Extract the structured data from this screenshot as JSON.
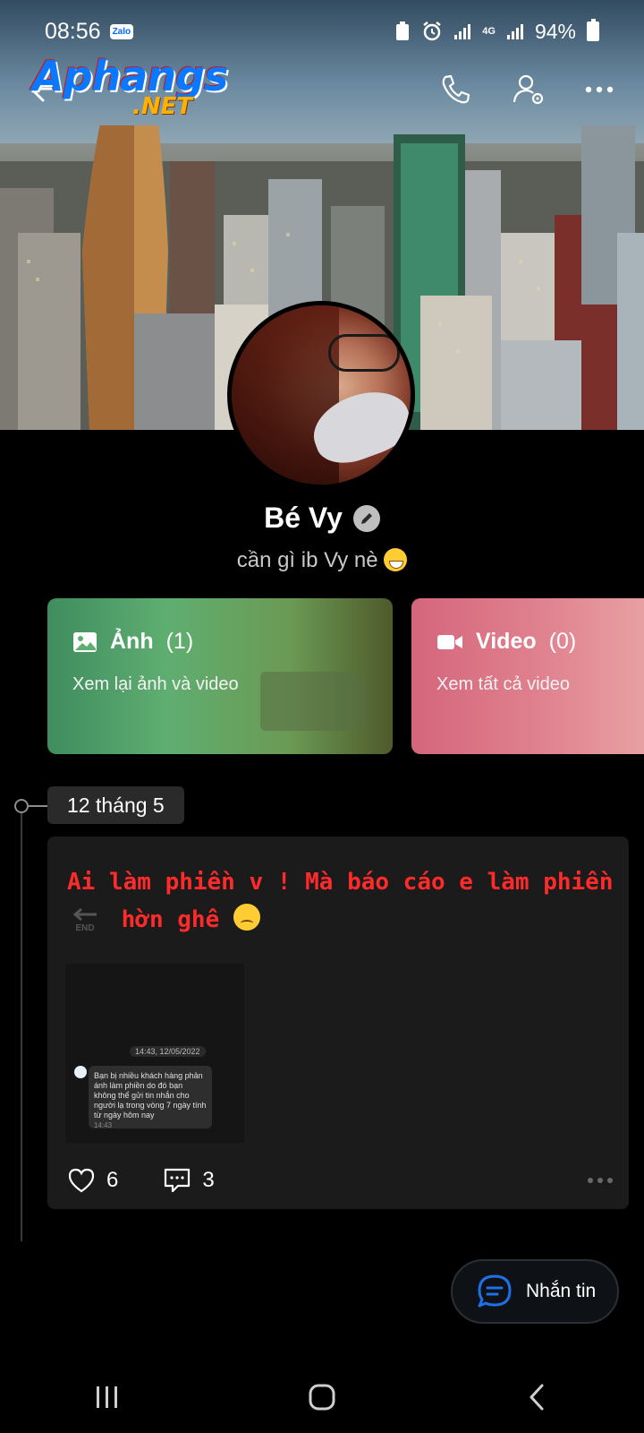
{
  "status_bar": {
    "time": "08:56",
    "notification_app": "Zalo",
    "network": "4G",
    "battery": "94%"
  },
  "header": {
    "logo_text": "Aphangs",
    "logo_suffix": ".NET",
    "icons": [
      "back-arrow-icon",
      "phone-icon",
      "user-settings-icon",
      "more-icon"
    ]
  },
  "profile": {
    "name": "Bé Vy",
    "bio": "cần gì ib Vy nè"
  },
  "media": {
    "photos": {
      "label": "Ảnh",
      "count": "(1)",
      "subtitle": "Xem lại ảnh và video"
    },
    "videos": {
      "label": "Video",
      "count": "(0)",
      "subtitle": "Xem tất cả video"
    }
  },
  "timeline": {
    "date": "12 tháng 5",
    "post": {
      "line1": "Ai làm phiền v ! Mà báo cáo e làm phiền",
      "line2": "hờn ghê",
      "end_label": "END",
      "thumb_time": "14:43, 12/05/2022",
      "thumb_message": "Bạn bị nhiều khách hàng phản ánh làm phiền do đó bạn không thể gửi tin nhắn cho người lạ trong vòng 7 ngày tính từ ngày hôm nay",
      "thumb_msg_time": "14:43",
      "likes": "6",
      "comments": "3"
    }
  },
  "fab": {
    "label": "Nhắn tin"
  },
  "colors": {
    "post_text": "#ff2a2a",
    "photo_card": "#5fae71",
    "video_card": "#e08290",
    "fab_icon": "#1e6fe8"
  }
}
